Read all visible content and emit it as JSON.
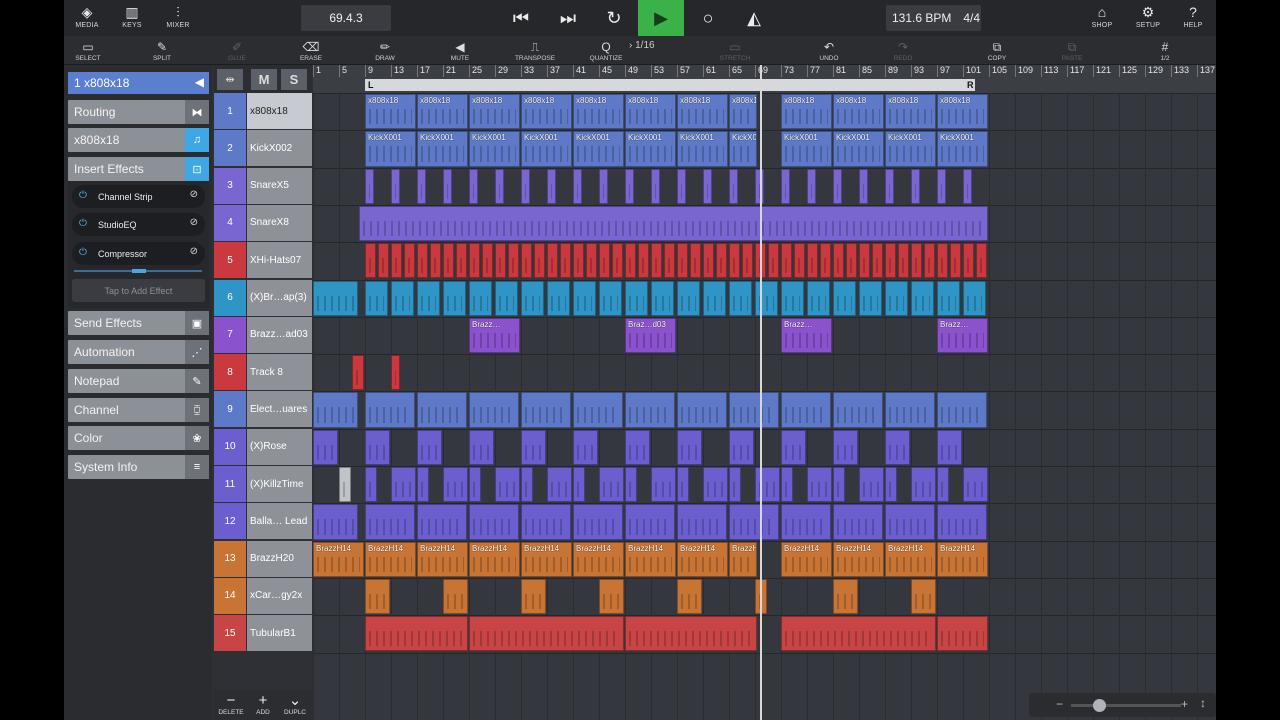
{
  "topbar": {
    "media": "MEDIA",
    "keys": "KEYS",
    "mixer": "MIXER",
    "position": "69.4.3",
    "tempo": "131.6 BPM",
    "signature": "4/4",
    "shop": "SHOP",
    "setup": "SETUP",
    "help": "HELP",
    "play_color": "#3bb14a"
  },
  "toolbar": {
    "select": "SELECT",
    "split": "SPLIT",
    "glue": "GLUE",
    "erase": "ERASE",
    "draw": "DRAW",
    "mute": "MUTE",
    "transpose": "TRANSPOSE",
    "quantize": "QUANTIZE",
    "quantize_value": "1/16",
    "stretch": "STRETCH",
    "undo": "UNDO",
    "redo": "REDO",
    "copy": "COPY",
    "paste": "PASTE",
    "grid": "1/2"
  },
  "inspector": {
    "track_header": "1  x808x18",
    "routing": "Routing",
    "instrument": "x808x18",
    "insert_effects": "Insert Effects",
    "plugins": [
      "Channel Strip",
      "StudioEQ",
      "Compressor"
    ],
    "add_effect": "Tap to Add Effect",
    "sections": [
      "Send Effects",
      "Automation",
      "Notepad",
      "Channel",
      "Color",
      "System Info"
    ]
  },
  "track_header": {
    "mute": "M",
    "solo": "S"
  },
  "tracks": [
    {
      "n": "1",
      "name": "x808x18",
      "color": "#5d79c8"
    },
    {
      "n": "2",
      "name": "KickX002",
      "color": "#5d79c8"
    },
    {
      "n": "3",
      "name": "SnareX5",
      "color": "#7a66d0"
    },
    {
      "n": "4",
      "name": "SnareX8",
      "color": "#7a66d0"
    },
    {
      "n": "5",
      "name": "XHi-Hats07",
      "color": "#c9393e"
    },
    {
      "n": "6",
      "name": "(X)Br…ap(3)",
      "color": "#2f95c6"
    },
    {
      "n": "7",
      "name": "Brazz…ad03",
      "color": "#8a52cc"
    },
    {
      "n": "8",
      "name": "Track 8",
      "color": "#c9393e"
    },
    {
      "n": "9",
      "name": "Elect…uares",
      "color": "#5d79c8"
    },
    {
      "n": "10",
      "name": "(X)Rose",
      "color": "#6b5fd0"
    },
    {
      "n": "11",
      "name": "(X)KillzTime",
      "color": "#6b5fd0"
    },
    {
      "n": "12",
      "name": "Balla… Lead",
      "color": "#6b5fd0"
    },
    {
      "n": "13",
      "name": "BrazzH20",
      "color": "#c87434"
    },
    {
      "n": "14",
      "name": "xCar…gy2x",
      "color": "#c87434"
    },
    {
      "n": "15",
      "name": "TubularB1",
      "color": "#c94444"
    }
  ],
  "bottom": {
    "delete": "DELETE",
    "add": "ADD",
    "duplicate": "DUPLC"
  },
  "ruler": {
    "bars": [
      "1",
      "5",
      "9",
      "13",
      "17",
      "21",
      "25",
      "29",
      "33",
      "37",
      "41",
      "45",
      "49",
      "53",
      "57",
      "61",
      "65",
      "69",
      "73",
      "77",
      "81",
      "85",
      "89",
      "93",
      "97",
      "101",
      "105",
      "109",
      "113",
      "117",
      "121",
      "125",
      "129",
      "133",
      "137"
    ],
    "loop_left": "L",
    "loop_right": "R"
  },
  "clips": {
    "t1_label": "x808x18",
    "t2_label": "KickX001",
    "t7_labels": [
      "Brazz…",
      "Braz…d03",
      "Brazz…",
      "Brazz…"
    ],
    "t13_label": "BrazzH14"
  }
}
